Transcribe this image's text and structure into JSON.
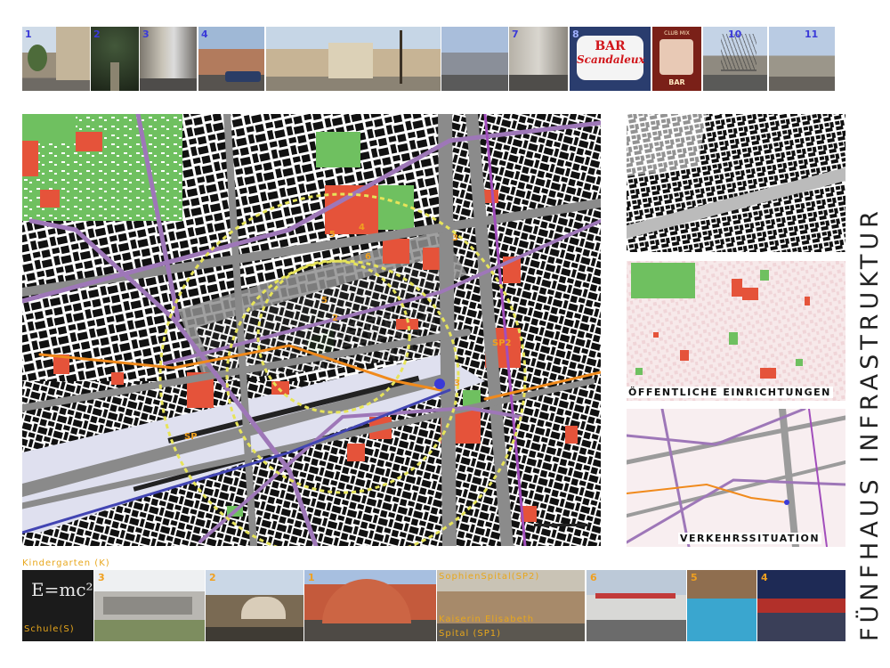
{
  "top_photos": [
    "1",
    "2",
    "3",
    "4",
    "",
    "",
    "7",
    "8",
    "",
    "",
    "10",
    "11"
  ],
  "bar_sign": {
    "line1": "BAR",
    "line2": "Scandaleux"
  },
  "bar_sign2": {
    "line1": "CLUB MIX",
    "line2": "BAR"
  },
  "map_labels": [
    "5",
    "4",
    "6",
    "3",
    "2",
    "SP2",
    "5",
    "3",
    "SP"
  ],
  "side_panels": {
    "public_facilities": "ÖFFENTLICHE EINRICHTUNGEN",
    "traffic": "VERKEHRSSITUATION"
  },
  "bottom": {
    "kindergarten": "Kindergarten (K)",
    "school": "Schule(S)",
    "sophienspital": "SophienSpital(SP2)",
    "kaiserin": "Kaiserin Elisabeth",
    "spital": "Spital (SP1)",
    "nums": [
      "3",
      "2",
      "1",
      "6",
      "5",
      "4"
    ]
  },
  "formula": "E=mc²",
  "vertical_title": "FÜNFHAUS INFRASTRUKTUR",
  "colors": {
    "accent": "#e8a71c",
    "blue_num": "#3a3ad8",
    "facility": "#e5533a",
    "green": "#6fc060"
  }
}
